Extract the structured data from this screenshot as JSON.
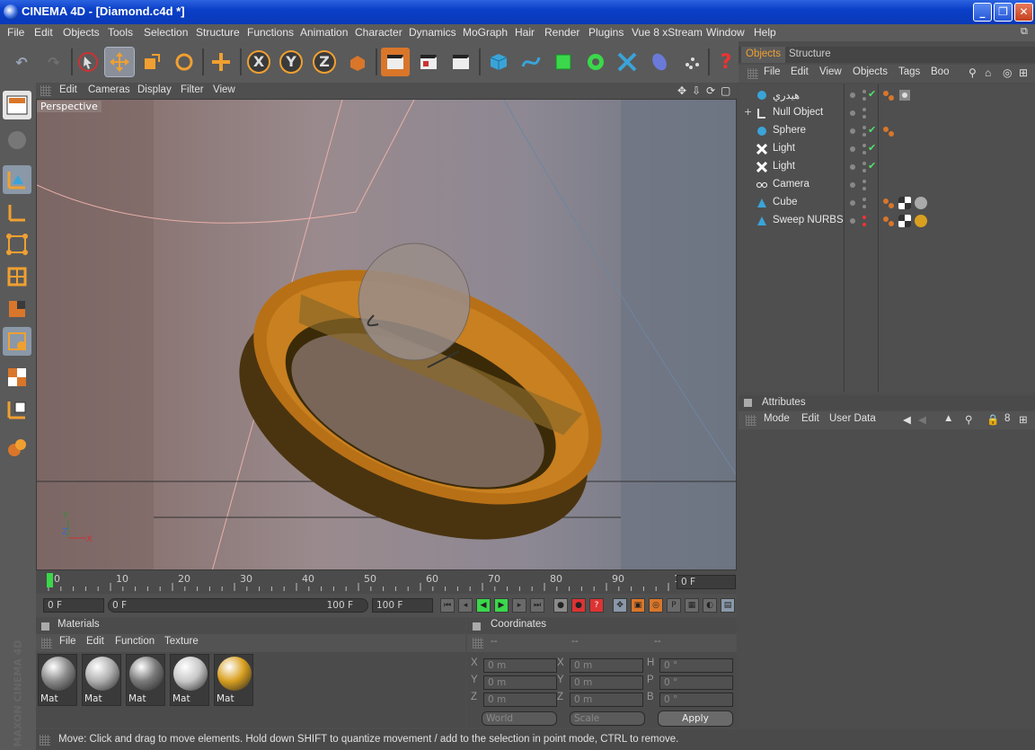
{
  "window": {
    "title": "CINEMA 4D - [Diamond.c4d *]",
    "minimize": "_",
    "restore": "❐",
    "close": "✕"
  },
  "menu": [
    "File",
    "Edit",
    "Objects",
    "Tools",
    "Selection",
    "Structure",
    "Functions",
    "Animation",
    "Character",
    "Dynamics",
    "MoGraph",
    "Hair",
    "Render",
    "Plugins",
    "Vue 8 xStream",
    "Window",
    "Help"
  ],
  "toolbar": {
    "axis_x": "X",
    "axis_y": "Y",
    "axis_z": "Z",
    "help": "?"
  },
  "viewport": {
    "menu": [
      "Edit",
      "Cameras",
      "Display",
      "Filter",
      "View"
    ],
    "camera_label": "Perspective",
    "axis_y": "Y",
    "axis_z": "Z",
    "axis_x": "X"
  },
  "timeline": {
    "ticks": [
      "0",
      "10",
      "20",
      "30",
      "40",
      "50",
      "60",
      "70",
      "80",
      "90",
      "100"
    ],
    "current_frame": "0 F",
    "start": "0 F",
    "range_start": "0 F",
    "range_end": "100 F",
    "end": "100 F"
  },
  "objects_panel": {
    "tabs": [
      "Objects",
      "Structure"
    ],
    "menu": [
      "File",
      "Edit",
      "View",
      "Objects",
      "Tags",
      "Boo"
    ],
    "items": [
      {
        "name": "هيدري",
        "icon": "sphere-icon",
        "vis": "gray",
        "check": true,
        "expand": ""
      },
      {
        "name": "Null Object",
        "icon": "null-icon",
        "vis": "gray",
        "check": false,
        "expand": "+"
      },
      {
        "name": "Sphere",
        "icon": "sphere-icon",
        "vis": "gray",
        "check": true,
        "expand": ""
      },
      {
        "name": "Light",
        "icon": "light-icon",
        "vis": "gray",
        "check": true,
        "expand": ""
      },
      {
        "name": "Light",
        "icon": "light-icon",
        "vis": "gray",
        "check": true,
        "expand": ""
      },
      {
        "name": "Camera",
        "icon": "camera-icon",
        "vis": "gray",
        "check": false,
        "expand": ""
      },
      {
        "name": "Cube",
        "icon": "cube-icon",
        "vis": "gray",
        "check": false,
        "expand": ""
      },
      {
        "name": "Sweep NURBS",
        "icon": "sweep-icon",
        "vis": "red",
        "check": false,
        "expand": ""
      }
    ]
  },
  "attributes_panel": {
    "title": "Attributes",
    "menu": [
      "Mode",
      "Edit",
      "User Data"
    ]
  },
  "materials_panel": {
    "title": "Materials",
    "menu": [
      "File",
      "Edit",
      "Function",
      "Texture"
    ],
    "items": [
      {
        "label": "Mat",
        "color": "#8a8a8a"
      },
      {
        "label": "Mat",
        "color": "#b0b0b0"
      },
      {
        "label": "Mat",
        "color": "#7a7a7a"
      },
      {
        "label": "Mat",
        "color": "#c8c8c8"
      },
      {
        "label": "Mat",
        "color": "#d9a020"
      }
    ]
  },
  "coordinates_panel": {
    "title": "Coordinates",
    "col_headers": [
      "--",
      "--",
      "--"
    ],
    "rows": [
      {
        "l1": "X",
        "v1": "0 m",
        "l2": "X",
        "v2": "0 m",
        "l3": "H",
        "v3": "0 °"
      },
      {
        "l1": "Y",
        "v1": "0 m",
        "l2": "Y",
        "v2": "0 m",
        "l3": "P",
        "v3": "0 °"
      },
      {
        "l1": "Z",
        "v1": "0 m",
        "l2": "Z",
        "v2": "0 m",
        "l3": "B",
        "v3": "0 °"
      }
    ],
    "mode_select": "World",
    "scale_select": "Scale",
    "apply": "Apply"
  },
  "status": "Move: Click and drag to move elements. Hold down SHIFT to quantize movement / add to the selection in point mode, CTRL to remove.",
  "branding": "MAXON CINEMA 4D",
  "colors": {
    "accent": "#d9762a",
    "highlight": "#f0a030",
    "check": "#4fe26a"
  }
}
